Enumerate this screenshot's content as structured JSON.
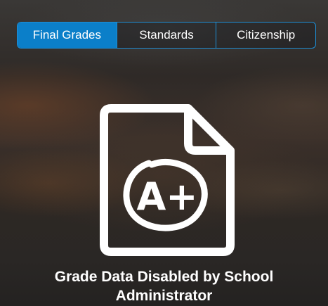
{
  "tabs": [
    {
      "label": "Final Grades",
      "active": true
    },
    {
      "label": "Standards",
      "active": false
    },
    {
      "label": "Citizenship",
      "active": false
    }
  ],
  "icon": "grade-document-a-plus-icon",
  "icon_text": "A+",
  "message": "Grade Data Disabled by School Administrator",
  "colors": {
    "accent": "#0b7fc9",
    "accent_border": "#1e8fd6",
    "icon": "#ffffff"
  }
}
